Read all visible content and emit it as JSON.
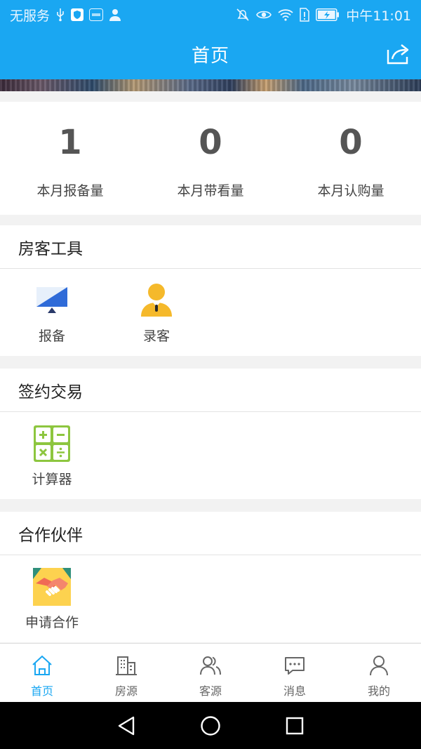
{
  "status_bar": {
    "carrier": "无服务",
    "time": "中午11:01",
    "icons": [
      "usb-icon",
      "shield-icon",
      "hms-icon",
      "person-icon",
      "mute-icon",
      "eye-icon",
      "wifi-icon",
      "sim-alert-icon",
      "battery-icon"
    ]
  },
  "header": {
    "title": "首页",
    "share_icon": "share-icon"
  },
  "stats": [
    {
      "value": "1",
      "label": "本月报备量"
    },
    {
      "value": "0",
      "label": "本月带看量"
    },
    {
      "value": "0",
      "label": "本月认购量"
    }
  ],
  "sections": [
    {
      "title": "房客工具",
      "tools": [
        {
          "label": "报备",
          "icon": "monitor-icon"
        },
        {
          "label": "录客",
          "icon": "customer-icon"
        }
      ]
    },
    {
      "title": "签约交易",
      "tools": [
        {
          "label": "计算器",
          "icon": "calculator-icon"
        }
      ]
    },
    {
      "title": "合作伙伴",
      "tools": [
        {
          "label": "申请合作",
          "icon": "handshake-icon"
        }
      ]
    }
  ],
  "tab_bar": [
    {
      "label": "首页",
      "icon": "home-icon",
      "active": true
    },
    {
      "label": "房源",
      "icon": "building-icon",
      "active": false
    },
    {
      "label": "客源",
      "icon": "users-icon",
      "active": false
    },
    {
      "label": "消息",
      "icon": "message-icon",
      "active": false
    },
    {
      "label": "我的",
      "icon": "profile-icon",
      "active": false
    }
  ],
  "nav_bar": [
    "back-icon",
    "home-circle-icon",
    "recents-icon"
  ],
  "colors": {
    "primary": "#1aa7f2",
    "background": "#f2f2f2",
    "stat_text": "#555555",
    "calculator_green": "#8dc63f",
    "customer_yellow": "#f5b92b",
    "monitor_blue": "#2f6bd8"
  }
}
